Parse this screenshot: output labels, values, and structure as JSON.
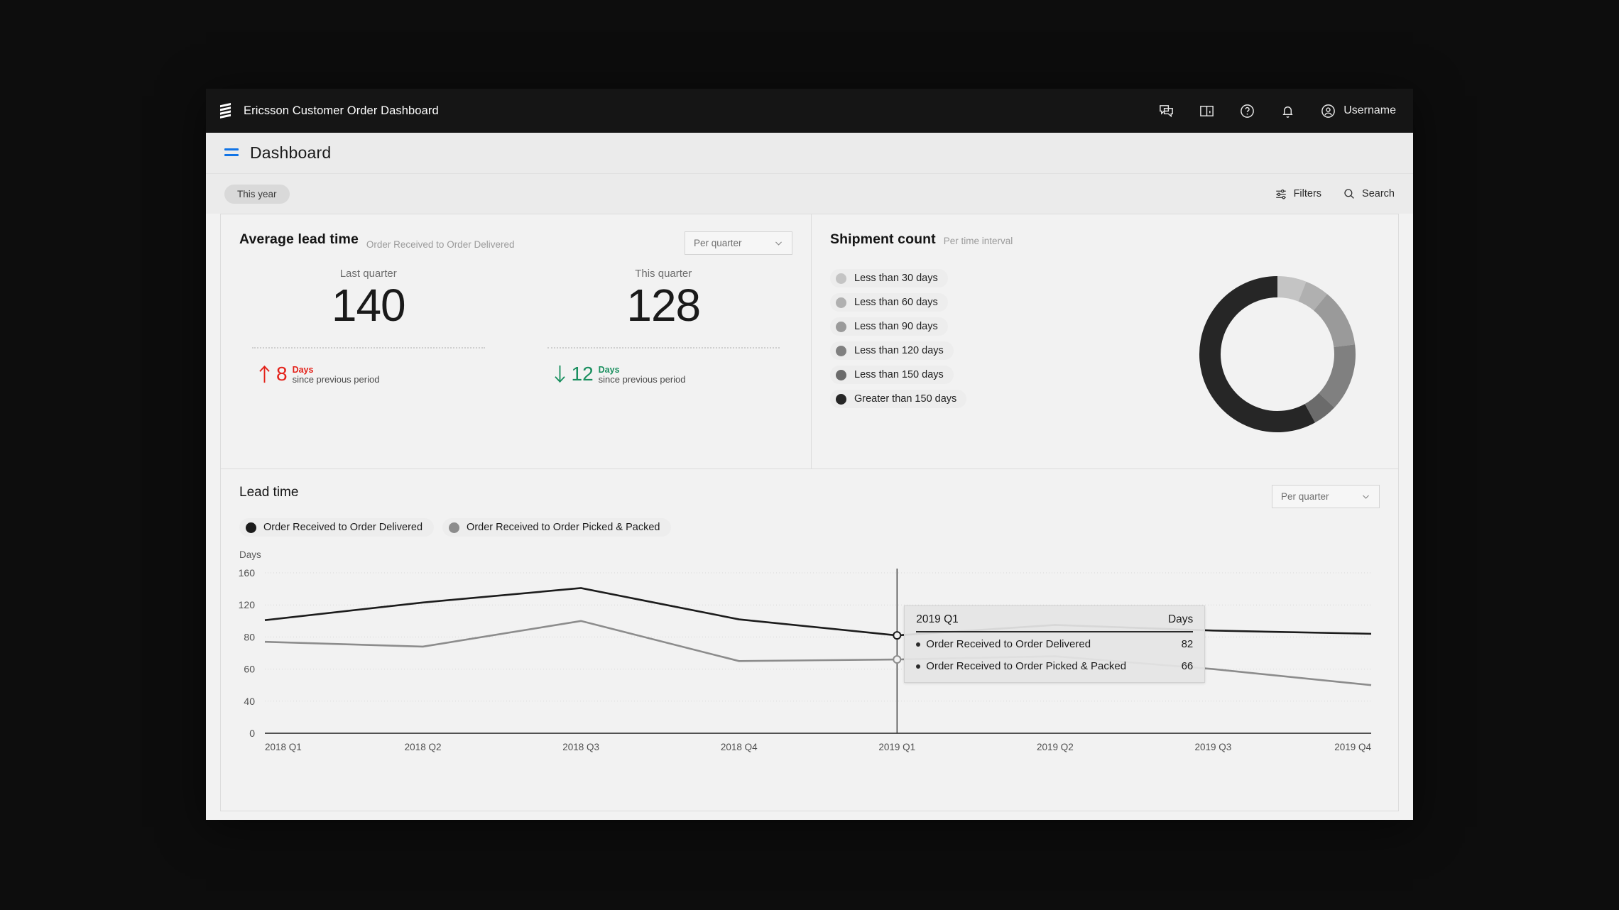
{
  "topbar": {
    "brand_title": "Ericsson Customer Order Dashboard",
    "icons": [
      "chat-icon",
      "book-icon",
      "help-icon",
      "bell-icon"
    ],
    "username": "Username"
  },
  "page_header": {
    "title": "Dashboard",
    "menu_icon": "hamburger-icon",
    "accent": "#1174e6"
  },
  "filterbar": {
    "chip": "This year",
    "filters_label": "Filters",
    "search_label": "Search"
  },
  "lead_time_card": {
    "title": "Average lead time",
    "subtitle": "Order Received to Order Delivered",
    "period_select": "Per quarter",
    "kpis": [
      {
        "label": "Last quarter",
        "value": "140",
        "direction": "up",
        "delta": "8",
        "unit": "Days",
        "note": "since previous period",
        "color": "#e32119"
      },
      {
        "label": "This quarter",
        "value": "128",
        "direction": "down",
        "delta": "12",
        "unit": "Days",
        "note": "since previous period",
        "color": "#1a8f5f"
      }
    ]
  },
  "shipment_card": {
    "title": "Shipment count",
    "subtitle": "Per time interval",
    "chart_data": {
      "type": "pie",
      "title": "Shipment count",
      "subtitle": "Per time interval",
      "legend_position": "left",
      "categories": [
        "Less than 30 days",
        "Less than 60 days",
        "Less than 90 days",
        "Less than 120 days",
        "Less than 150 days",
        "Greater than 150 days"
      ],
      "values": [
        6,
        5,
        12,
        14,
        5,
        58
      ],
      "colors": [
        "#c4c4c4",
        "#b0b0b0",
        "#9a9a9a",
        "#808080",
        "#6b6b6b",
        "#262626"
      ]
    }
  },
  "chart_card": {
    "title": "Lead time",
    "period_select": "Per quarter",
    "legend": [
      {
        "label": "Order Received to Order Delivered",
        "color": "#1c1c1c"
      },
      {
        "label": "Order Received to Order Picked & Packed",
        "color": "#8c8c8c"
      }
    ],
    "chart_data": {
      "type": "line",
      "title": "Lead time",
      "ylabel": "Days",
      "xlabel": "",
      "grid": true,
      "ylim": [
        0,
        180
      ],
      "yticks": [
        "160",
        "120",
        "80",
        "60",
        "40",
        "0"
      ],
      "categories": [
        "2018 Q1",
        "2018 Q2",
        "2018 Q3",
        "2018 Q4",
        "2019 Q1",
        "2019 Q2",
        "2019 Q3",
        "2019 Q4"
      ],
      "series": [
        {
          "name": "Order Received to Order Delivered",
          "color": "#1c1c1c",
          "values": [
            101,
            123,
            141,
            102,
            82,
            95,
            88,
            84
          ]
        },
        {
          "name": "Order Received to Order Picked & Packed",
          "color": "#8c8c8c",
          "values": [
            77,
            74,
            100,
            65,
            66,
            68,
            60,
            50
          ]
        }
      ]
    },
    "tooltip": {
      "quarter": "2019 Q1",
      "unit_header": "Days",
      "rows": [
        {
          "name": "Order Received to Order Delivered",
          "value": "82"
        },
        {
          "name": "Order Received to Order Picked & Packed",
          "value": "66"
        }
      ]
    }
  }
}
